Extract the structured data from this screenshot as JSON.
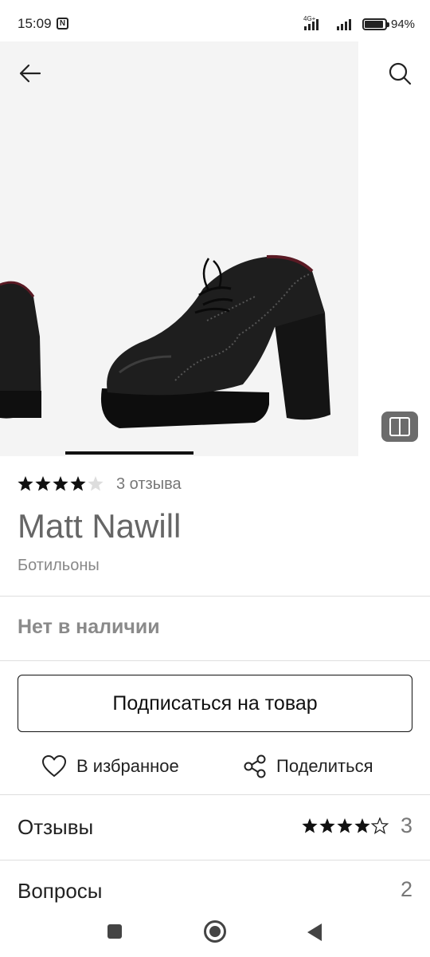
{
  "status_bar": {
    "time": "15:09",
    "nfc": "N",
    "network": "4G+",
    "battery_percent": "94%",
    "battery_level": 0.94
  },
  "product": {
    "rating": 4.5,
    "rating_max": 5,
    "reviews_link": "3 отзыва",
    "brand": "Matt Nawill",
    "category": "Ботильоны",
    "stock_status": "Нет в наличии",
    "image_index": 1
  },
  "actions": {
    "subscribe_label": "Подписаться на товар",
    "favorite_label": "В избранное",
    "share_label": "Поделиться"
  },
  "sections": {
    "reviews": {
      "title": "Отзывы",
      "rating": 4,
      "count": "3"
    },
    "questions": {
      "title": "Вопросы",
      "count": "2"
    }
  },
  "icons": {
    "back": "arrow-left-icon",
    "search": "search-icon",
    "gallery": "gallery-icon",
    "favorite": "heart-icon",
    "share": "share-icon"
  },
  "colors": {
    "accent": "#111111",
    "muted_text": "#8a8a8a",
    "divider": "#dedede"
  }
}
